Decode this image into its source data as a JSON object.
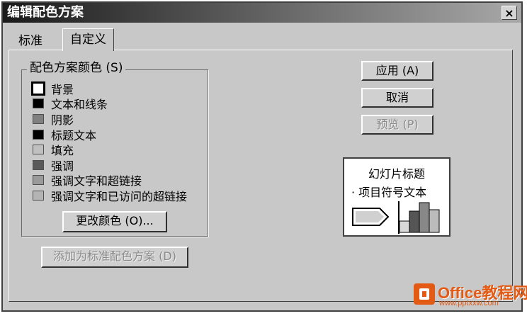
{
  "window": {
    "title": "编辑配色方案",
    "close_label": "×"
  },
  "tabs": [
    {
      "label": "标准"
    },
    {
      "label": "自定义"
    }
  ],
  "color_scheme": {
    "group_title": "配色方案颜色 (S)",
    "items": [
      {
        "label": "背景",
        "color": "#ffffff",
        "selected": true
      },
      {
        "label": "文本和线条",
        "color": "#000000"
      },
      {
        "label": "阴影",
        "color": "#808080"
      },
      {
        "label": "标题文本",
        "color": "#000000"
      },
      {
        "label": "填充",
        "color": "#c0c0c0"
      },
      {
        "label": "强调",
        "color": "#5a5a5a"
      },
      {
        "label": "强调文字和超链接",
        "color": "#9a9a9a"
      },
      {
        "label": "强调文字和已访问的超链接",
        "color": "#b4b4b4"
      }
    ],
    "change_color_label": "更改颜色 (O)..."
  },
  "add_standard_label": "添加为标准配色方案 (D)",
  "buttons": {
    "apply": "应用 (A)",
    "cancel": "取消",
    "preview": "预览 (P)"
  },
  "preview": {
    "title": "幻灯片标题",
    "bullet": "· 项目符号文本"
  },
  "watermark": {
    "brand": "Office教程网",
    "url": "www.pptxxw.com"
  }
}
